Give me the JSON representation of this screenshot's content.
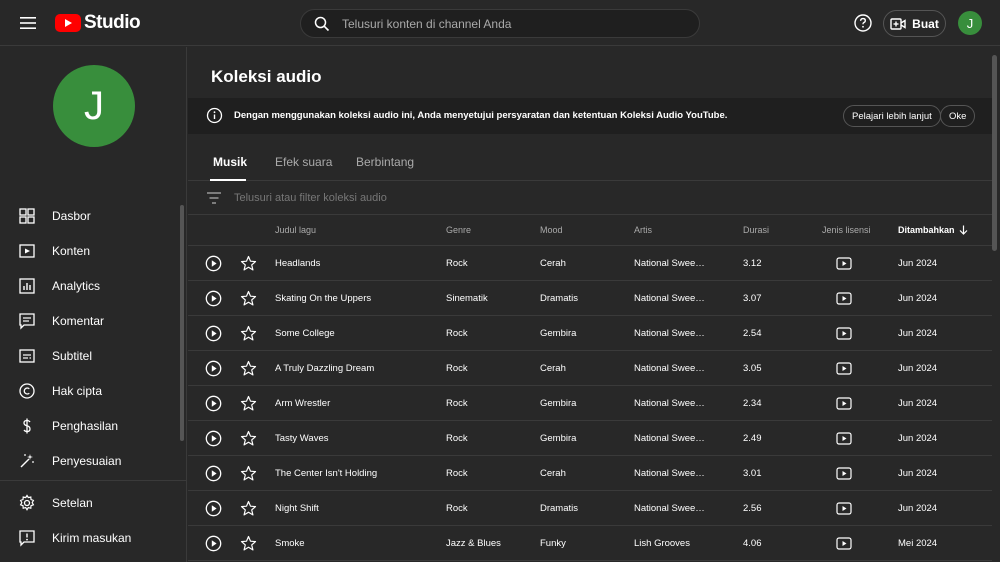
{
  "header": {
    "logo_text": "Studio",
    "search_placeholder": "Telusuri konten di channel Anda",
    "create_label": "Buat",
    "avatar_letter": "J"
  },
  "sidebar": {
    "avatar_letter": "J",
    "items": [
      {
        "label": "Dasbor",
        "icon": "dashboard-icon"
      },
      {
        "label": "Konten",
        "icon": "content-icon"
      },
      {
        "label": "Analytics",
        "icon": "analytics-icon"
      },
      {
        "label": "Komentar",
        "icon": "comments-icon"
      },
      {
        "label": "Subtitel",
        "icon": "subtitles-icon"
      },
      {
        "label": "Hak cipta",
        "icon": "copyright-icon"
      },
      {
        "label": "Penghasilan",
        "icon": "dollar-icon"
      },
      {
        "label": "Penyesuaian",
        "icon": "magic-wand-icon"
      }
    ],
    "bottom_items": [
      {
        "label": "Setelan",
        "icon": "gear-icon"
      },
      {
        "label": "Kirim masukan",
        "icon": "feedback-icon"
      }
    ]
  },
  "main": {
    "title": "Koleksi audio",
    "notice": {
      "text": "Dengan menggunakan koleksi audio ini, Anda menyetujui persyaratan dan ketentuan Koleksi Audio YouTube.",
      "learn_more": "Pelajari lebih lanjut",
      "ok": "Oke"
    },
    "tabs": [
      "Musik",
      "Efek suara",
      "Berbintang"
    ],
    "filter_placeholder": "Telusuri atau filter koleksi audio",
    "columns": {
      "title": "Judul lagu",
      "genre": "Genre",
      "mood": "Mood",
      "artist": "Artis",
      "duration": "Durasi",
      "license": "Jenis lisensi",
      "added": "Ditambahkan"
    },
    "rows": [
      {
        "title": "Headlands",
        "genre": "Rock",
        "mood": "Cerah",
        "artist": "National Swee…",
        "duration": "3.12",
        "added": "Jun 2024"
      },
      {
        "title": "Skating On the Uppers",
        "genre": "Sinematik",
        "mood": "Dramatis",
        "artist": "National Swee…",
        "duration": "3.07",
        "added": "Jun 2024"
      },
      {
        "title": "Some College",
        "genre": "Rock",
        "mood": "Gembira",
        "artist": "National Swee…",
        "duration": "2.54",
        "added": "Jun 2024"
      },
      {
        "title": "A Truly Dazzling Dream",
        "genre": "Rock",
        "mood": "Cerah",
        "artist": "National Swee…",
        "duration": "3.05",
        "added": "Jun 2024"
      },
      {
        "title": "Arm Wrestler",
        "genre": "Rock",
        "mood": "Gembira",
        "artist": "National Swee…",
        "duration": "2.34",
        "added": "Jun 2024"
      },
      {
        "title": "Tasty Waves",
        "genre": "Rock",
        "mood": "Gembira",
        "artist": "National Swee…",
        "duration": "2.49",
        "added": "Jun 2024"
      },
      {
        "title": "The Center Isn't Holding",
        "genre": "Rock",
        "mood": "Cerah",
        "artist": "National Swee…",
        "duration": "3.01",
        "added": "Jun 2024"
      },
      {
        "title": "Night Shift",
        "genre": "Rock",
        "mood": "Dramatis",
        "artist": "National Swee…",
        "duration": "2.56",
        "added": "Jun 2024"
      },
      {
        "title": "Smoke",
        "genre": "Jazz & Blues",
        "mood": "Funky",
        "artist": "Lish Grooves",
        "duration": "4.06",
        "added": "Mei 2024"
      }
    ]
  }
}
